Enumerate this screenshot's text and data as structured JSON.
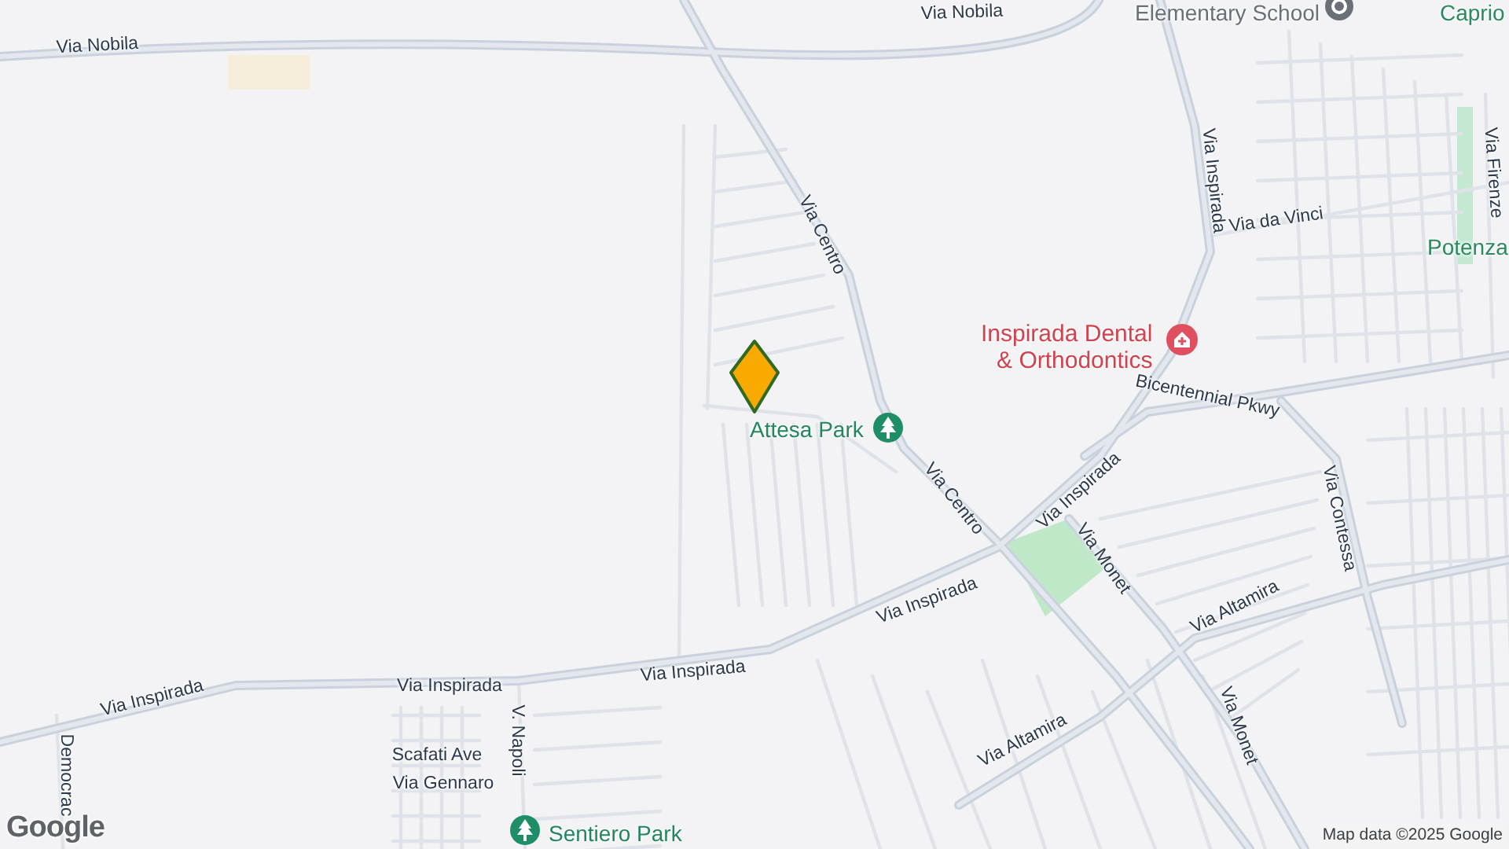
{
  "map": {
    "road_labels": [
      {
        "text": "Via Nobila"
      },
      {
        "text": "Via Nobila"
      },
      {
        "text": "Via Centro"
      },
      {
        "text": "Via Inspirada"
      },
      {
        "text": "Via da Vinci"
      },
      {
        "text": "Via Firenze"
      },
      {
        "text": "Bicentennial Pkwy"
      },
      {
        "text": "Via Contessa"
      },
      {
        "text": "Via Centro"
      },
      {
        "text": "Via Inspirada"
      },
      {
        "text": "Via Monet"
      },
      {
        "text": "Via Inspirada"
      },
      {
        "text": "Via Altamira"
      },
      {
        "text": "Via Altamira"
      },
      {
        "text": "Via Monet"
      },
      {
        "text": "Via Inspirada"
      },
      {
        "text": "Via Inspirada"
      },
      {
        "text": "Via Inspirada"
      },
      {
        "text": "V. Napoli"
      },
      {
        "text": "Scafati Ave"
      },
      {
        "text": "Via Gennaro"
      },
      {
        "text": "Democrac"
      }
    ],
    "places": [
      {
        "text": "Elementary School",
        "kind": "school"
      },
      {
        "text": "Caprio",
        "kind": "area"
      },
      {
        "text": "Potenza",
        "kind": "area"
      },
      {
        "text": "Inspirada Dental\n& Orthodontics",
        "kind": "dental"
      },
      {
        "text": "Attesa Park",
        "kind": "park"
      },
      {
        "text": "Sentiero Park",
        "kind": "park"
      }
    ],
    "logo": "Google",
    "attribution": "Map data ©2025 Google"
  }
}
